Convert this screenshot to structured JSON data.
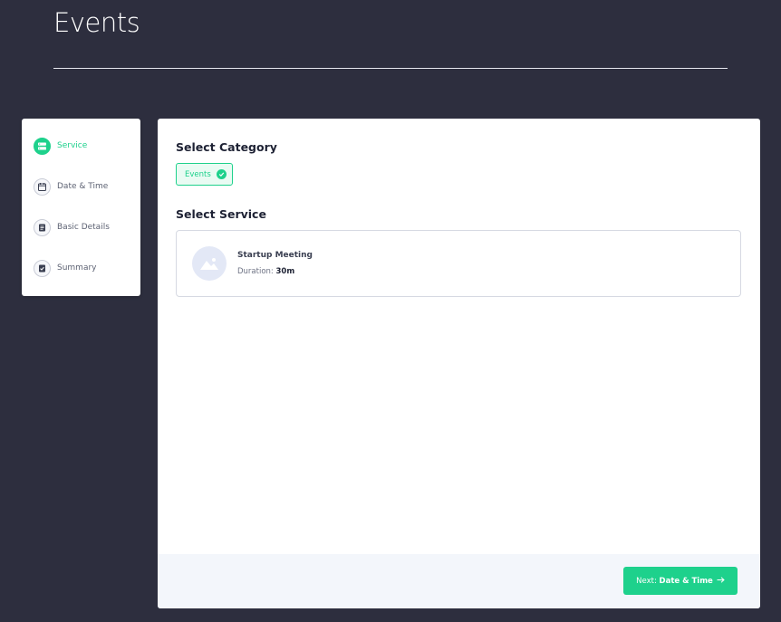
{
  "page": {
    "title": "Events"
  },
  "steps": [
    {
      "label": "Service",
      "icon": "list-icon",
      "active": true
    },
    {
      "label": "Date & Time",
      "icon": "calendar-icon",
      "active": false
    },
    {
      "label": "Basic Details",
      "icon": "document-icon",
      "active": false
    },
    {
      "label": "Summary",
      "icon": "checklist-icon",
      "active": false
    }
  ],
  "category": {
    "heading": "Select Category",
    "selected": {
      "label": "Events",
      "icon": "check-circle-icon"
    }
  },
  "service": {
    "heading": "Select Service",
    "items": [
      {
        "name": "Startup Meeting",
        "duration_label": "Duration:",
        "duration_value": "30m",
        "icon": "image-placeholder-icon"
      }
    ]
  },
  "footer": {
    "next_prefix": "Next:",
    "next_target": "Date & Time",
    "next_icon": "arrow-right-icon"
  },
  "colors": {
    "background": "#2d2e3e",
    "accent": "#1ed18c",
    "card": "#ffffff",
    "footer": "#f3f6fb"
  }
}
